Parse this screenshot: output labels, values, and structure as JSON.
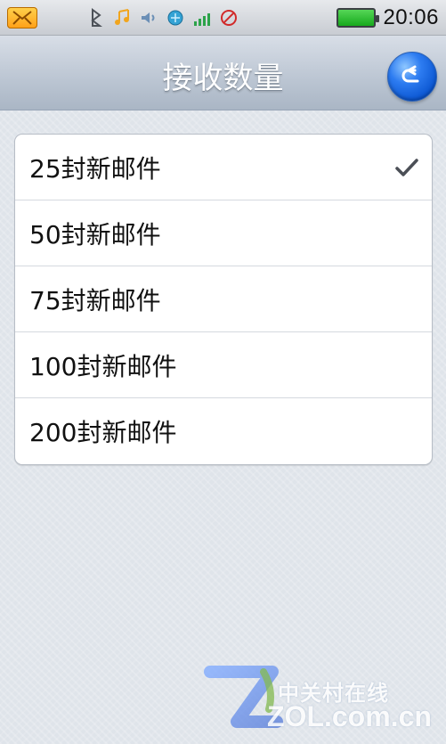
{
  "status_bar": {
    "time": "20:06",
    "icons": [
      "envelope-icon",
      "bluetooth-icon",
      "music-note-icon",
      "speaker-icon",
      "sync-globe-icon",
      "signal-3g-icon",
      "alarm-disabled-icon",
      "battery-icon"
    ]
  },
  "header": {
    "title": "接收数量",
    "back_icon": "back-arrow-icon"
  },
  "list": {
    "items": [
      {
        "label": "25封新邮件",
        "selected": true
      },
      {
        "label": "50封新邮件",
        "selected": false
      },
      {
        "label": "75封新邮件",
        "selected": false
      },
      {
        "label": "100封新邮件",
        "selected": false
      },
      {
        "label": "200封新邮件",
        "selected": false
      }
    ],
    "check_icon": "checkmark-icon"
  },
  "watermark": {
    "chinese": "中关村在线",
    "english": "ZOL.com.cn"
  },
  "colors": {
    "header_text": "#ffffff",
    "list_text": "#111111",
    "back_button_blue": "#0b56d1",
    "battery_green": "#16a91c"
  }
}
